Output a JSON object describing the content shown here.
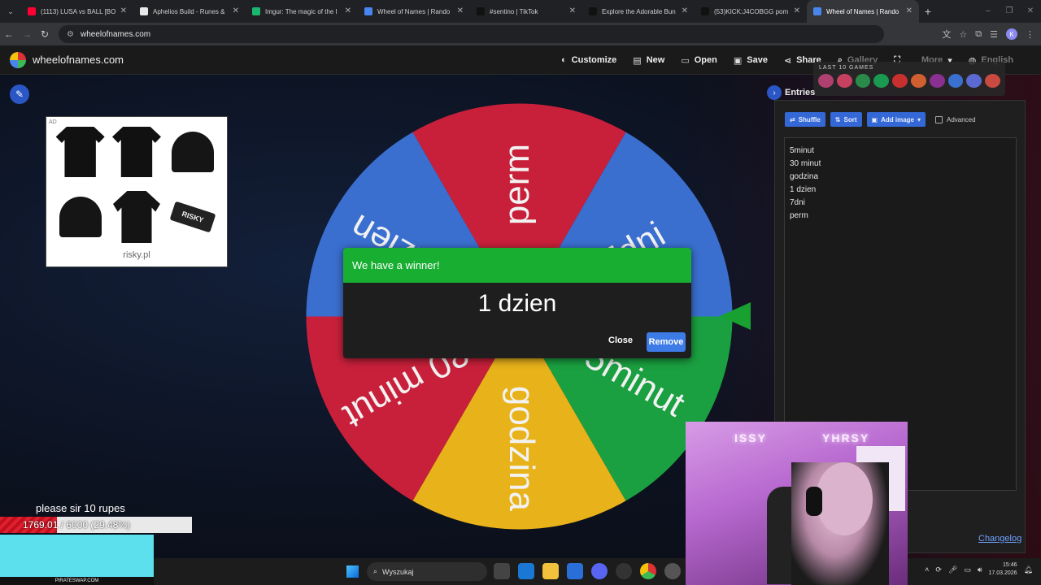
{
  "browser": {
    "tabs": [
      {
        "label": "(1113) LUSA vs BALL [BO",
        "color": "#ff0033",
        "active": false
      },
      {
        "label": "Aphelios Build - Runes &",
        "color": "#e8e8e8",
        "active": false
      },
      {
        "label": "Imgur: The magic of the I",
        "color": "#1bb76e",
        "active": false
      },
      {
        "label": "Wheel of Names | Rando",
        "color": "#4885ed",
        "active": false
      },
      {
        "label": "#sentino | TikTok",
        "color": "#111111",
        "active": false
      },
      {
        "label": "Explore the Adorable Bun",
        "color": "#111111",
        "active": false
      },
      {
        "label": "(53)KICK:J4COBGG pom",
        "color": "#111111",
        "active": false
      },
      {
        "label": "Wheel of Names | Rando",
        "color": "#4885ed",
        "active": true
      }
    ],
    "new_tab": "+",
    "url": "wheelofnames.com",
    "profile_initial": "K"
  },
  "app": {
    "site_name": "wheelofnames.com",
    "menu": [
      {
        "label": "Customize",
        "icon": "palette-icon",
        "dim": false
      },
      {
        "label": "New",
        "icon": "file-icon",
        "dim": false
      },
      {
        "label": "Open",
        "icon": "folder-icon",
        "dim": false
      },
      {
        "label": "Save",
        "icon": "save-icon",
        "dim": false
      },
      {
        "label": "Share",
        "icon": "share-icon",
        "dim": false
      },
      {
        "label": "Gallery",
        "icon": "search-icon",
        "dim": true
      },
      {
        "label": "",
        "icon": "fullscreen-icon",
        "dim": true
      },
      {
        "label": "More",
        "icon": "chevron-down-icon",
        "dim": true
      },
      {
        "label": "English",
        "icon": "globe-icon",
        "dim": true
      }
    ],
    "last10_label": "LAST 10 GAMES",
    "ad": {
      "tag": "AD",
      "url": "risky.pl",
      "keychain_text": "RISKY"
    }
  },
  "wheel": {
    "slices": [
      {
        "label": "7dni",
        "color": "#3a6fd0"
      },
      {
        "label": "5minut",
        "color": "#1aa040"
      },
      {
        "label": "godzina",
        "color": "#e8b21a"
      },
      {
        "label": "30 minut",
        "color": "#c8203a"
      },
      {
        "label": "1 dzien",
        "color": "#3a6fd0"
      },
      {
        "label": "perm",
        "color": "#c8203a"
      }
    ]
  },
  "entries_panel": {
    "toggle_label": "Entries",
    "shuffle": "Shuffle",
    "sort": "Sort",
    "add_image": "Add image",
    "advanced": "Advanced",
    "entries": [
      "5minut",
      "30 minut",
      "godzina",
      "1 dzien",
      "7dni",
      "perm"
    ],
    "changelog": "Changelog"
  },
  "modal": {
    "title": "We have a winner!",
    "winner": "1 dzien",
    "close": "Close",
    "remove": "Remove"
  },
  "overlay": {
    "donation_text": "please sir 10 rupes",
    "progress_text": "1769.01 / 6000 (29.48%)",
    "progress_fraction": 0.2948,
    "cyan_caption": "PIRATESWAP.COM"
  },
  "webcam": {
    "neon_left": "ISSY",
    "neon_right": "YHRSY"
  },
  "taskbar": {
    "search_placeholder": "Wyszukaj",
    "time": "15:46",
    "date": "17.03.2026"
  }
}
